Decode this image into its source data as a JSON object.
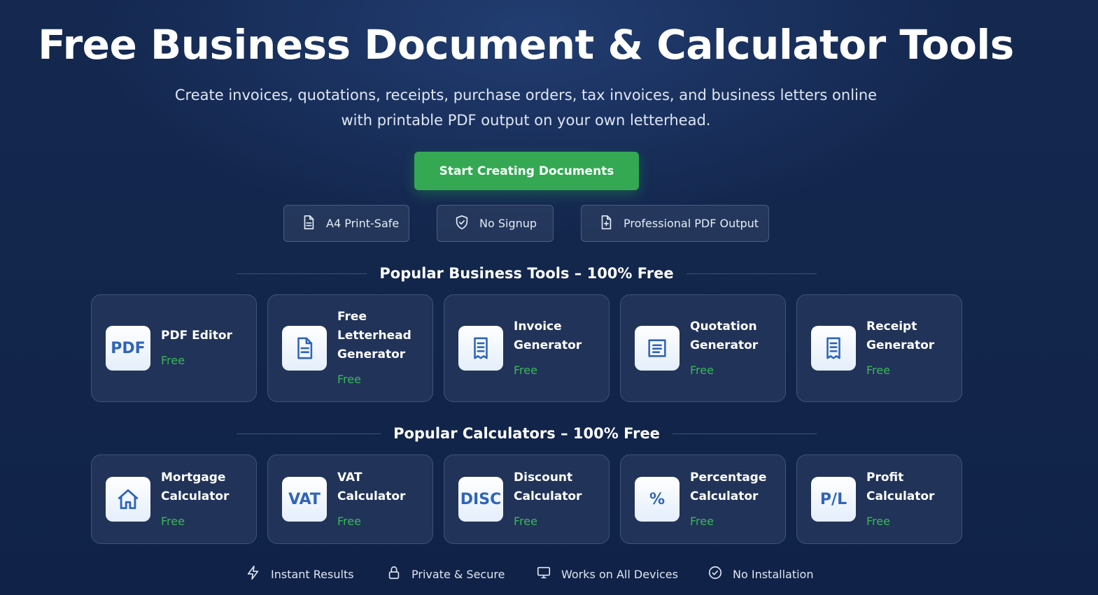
{
  "hero": {
    "title": "Free Business Document & Calculator Tools",
    "subtitle_line1": "Create invoices, quotations, receipts, purchase orders, tax invoices, and business letters online",
    "subtitle_line2": "with printable PDF output on your own letterhead.",
    "cta_label": "Start Creating Documents"
  },
  "badges": [
    {
      "label": "A4 Print-Safe",
      "icon": "document-icon"
    },
    {
      "label": "No Signup",
      "icon": "shield-check-icon"
    },
    {
      "label": "Professional PDF Output",
      "icon": "document-plus-icon"
    }
  ],
  "business_section": {
    "heading": "Popular Business Tools – 100% Free",
    "tools": [
      {
        "line1": "PDF Editor",
        "line2": "",
        "line3": "",
        "free": "Free",
        "icon": "PDF"
      },
      {
        "line1": "Free",
        "line2": "Letterhead",
        "line3": "Generator",
        "free": "Free",
        "icon": "document-lines-icon"
      },
      {
        "line1": "Invoice",
        "line2": "Generator",
        "line3": "",
        "free": "Free",
        "icon": "receipt-icon"
      },
      {
        "line1": "Quotation",
        "line2": "Generator",
        "line3": "",
        "free": "Free",
        "icon": "list-doc-icon"
      },
      {
        "line1": "Receipt",
        "line2": "Generator",
        "line3": "",
        "free": "Free",
        "icon": "receipt-icon"
      }
    ]
  },
  "calculators_section": {
    "heading": "Popular Calculators – 100% Free",
    "tools": [
      {
        "line1": "Mortgage",
        "line2": "Calculator",
        "free": "Free",
        "icon": "house-icon"
      },
      {
        "line1": "VAT",
        "line2": "Calculator",
        "free": "Free",
        "icon": "VAT"
      },
      {
        "line1": "Discount",
        "line2": "Calculator",
        "free": "Free",
        "icon": "DISC"
      },
      {
        "line1": "Percentage",
        "line2": "Calculator",
        "free": "Free",
        "icon": "%"
      },
      {
        "line1": "Profit",
        "line2": "Calculator",
        "free": "Free",
        "icon": "P/L"
      }
    ]
  },
  "features": [
    {
      "label": "Instant Results",
      "icon": "lightning-icon"
    },
    {
      "label": "Private & Secure",
      "icon": "lock-icon"
    },
    {
      "label": "Works on All Devices",
      "icon": "monitor-icon"
    },
    {
      "label": "No Installation",
      "icon": "check-circle-icon"
    }
  ],
  "colors": {
    "background": "#13264c",
    "cta": "#34a853",
    "free_text": "#39b957",
    "icon_blue": "#2f64b8"
  }
}
